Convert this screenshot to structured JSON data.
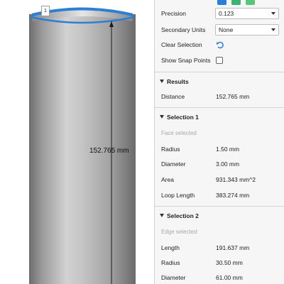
{
  "viewport": {
    "measure_label": "152.765 mm",
    "pin_label": "1"
  },
  "panel": {
    "settings": {
      "precision_label": "Precision",
      "precision_value": "0.123",
      "secondary_units_label": "Secondary Units",
      "secondary_units_value": "None",
      "clear_selection_label": "Clear Selection",
      "show_snap_points_label": "Show Snap Points"
    },
    "results": {
      "title": "Results",
      "distance_label": "Distance",
      "distance_value": "152.765 mm"
    },
    "selection1": {
      "title": "Selection 1",
      "subtitle": "Face selected",
      "rows": [
        {
          "label": "Radius",
          "value": "1.50 mm"
        },
        {
          "label": "Diameter",
          "value": "3.00 mm"
        },
        {
          "label": "Area",
          "value": "931.343 mm^2"
        },
        {
          "label": "Loop Length",
          "value": "383.274 mm"
        }
      ]
    },
    "selection2": {
      "title": "Selection 2",
      "subtitle": "Edge selected",
      "rows": [
        {
          "label": "Length",
          "value": "191.637 mm"
        },
        {
          "label": "Radius",
          "value": "30.50 mm"
        },
        {
          "label": "Diameter",
          "value": "61.00 mm"
        }
      ]
    }
  },
  "colors": {
    "accent_blue": "#2d7fd6",
    "filter_green": "#3cb371",
    "can_body": "#a9a9a9",
    "can_rim": "#3a7fd5"
  },
  "icons": {
    "clear_selection": "reset-arrow-icon",
    "section_toggle": "triangle-down-icon"
  }
}
